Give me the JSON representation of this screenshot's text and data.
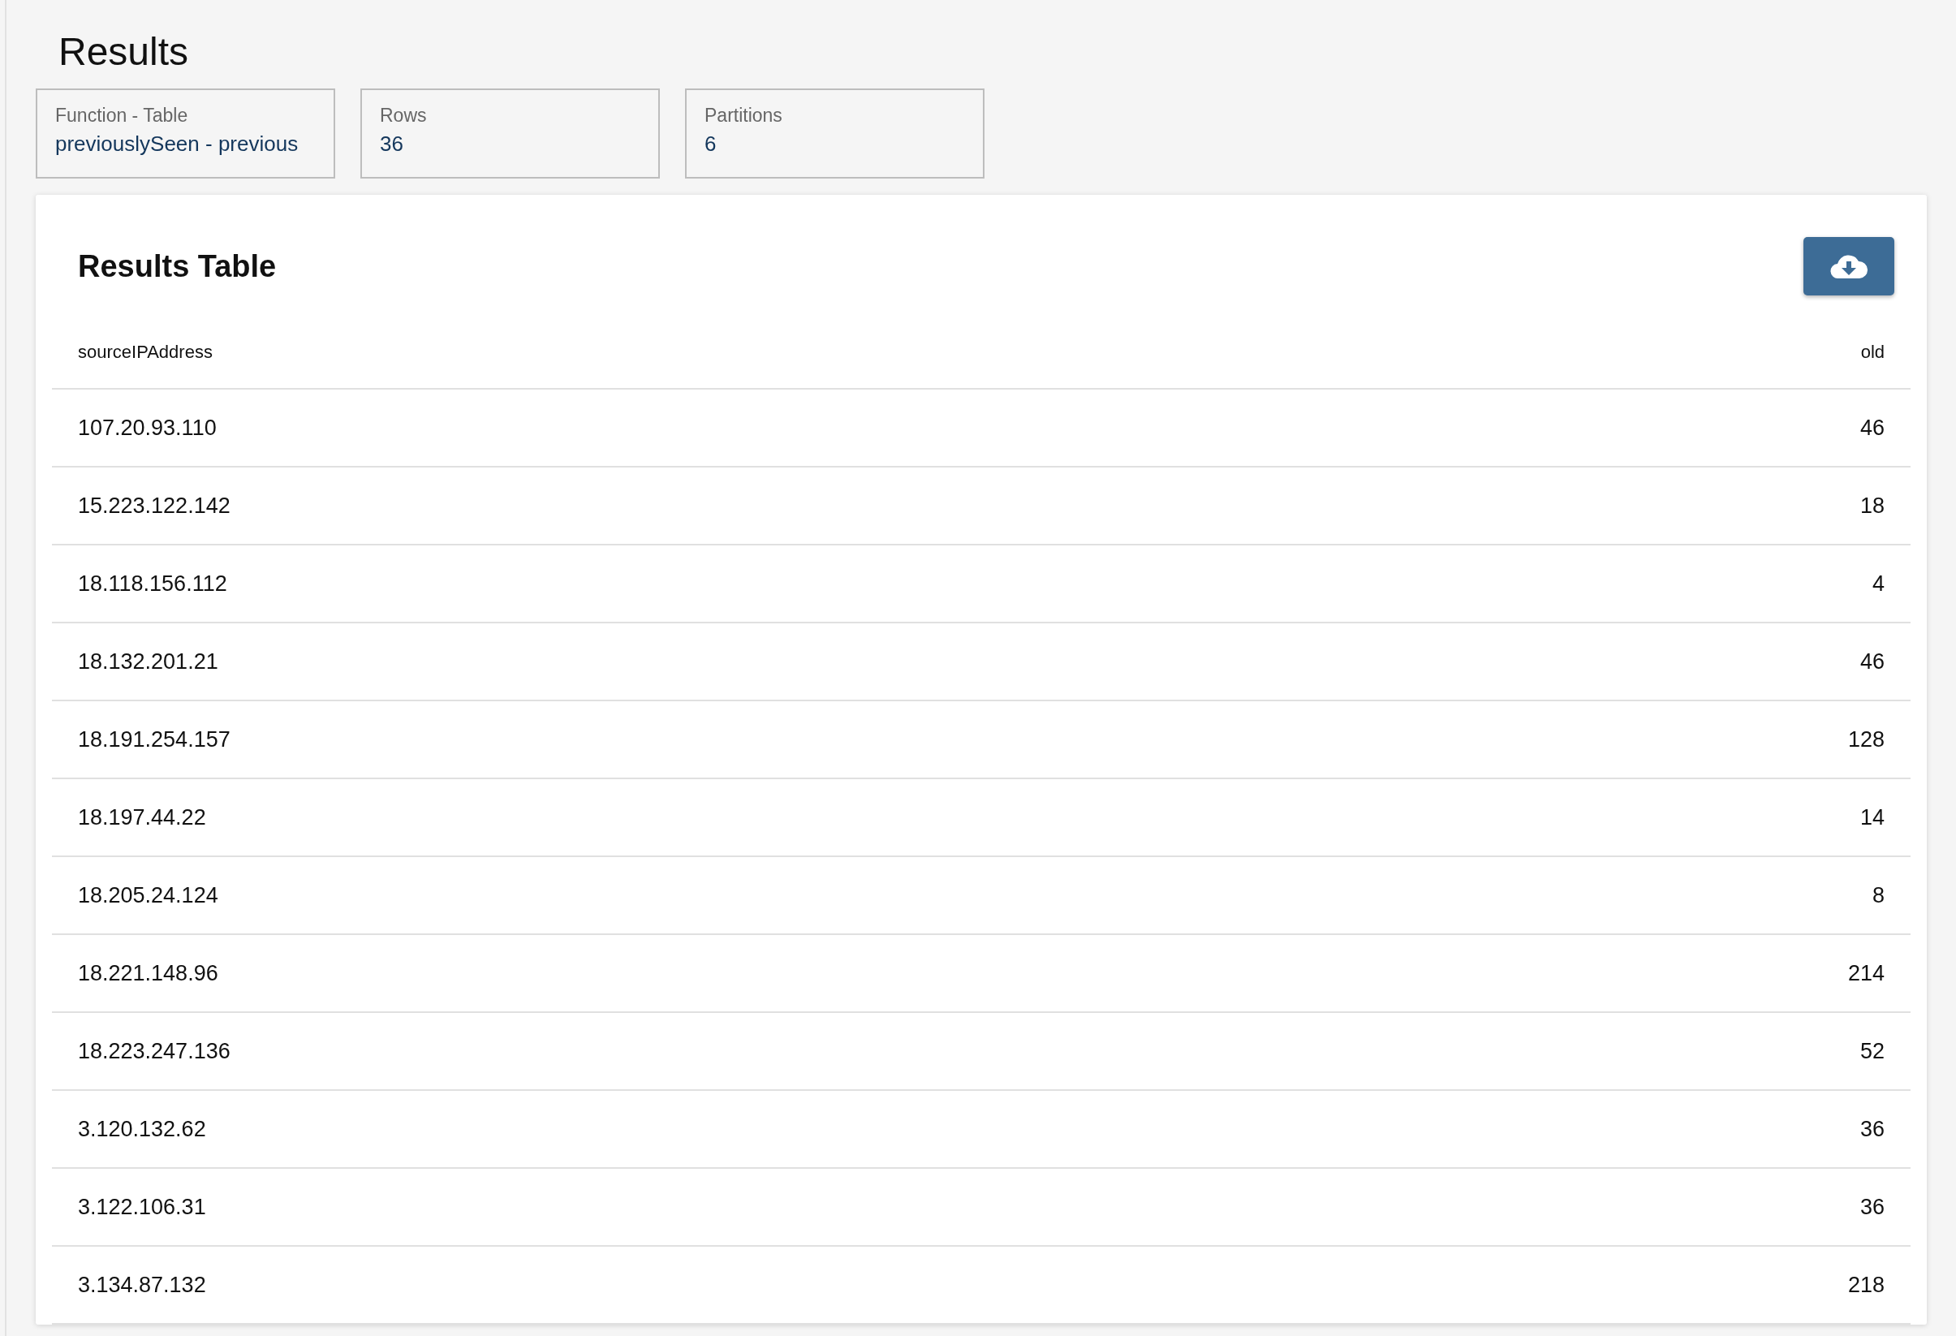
{
  "page_title": "Results",
  "stats": [
    {
      "label": "Function - Table",
      "value": "previouslySeen - previous"
    },
    {
      "label": "Rows",
      "value": "36"
    },
    {
      "label": "Partitions",
      "value": "6"
    }
  ],
  "results_table": {
    "title": "Results Table",
    "columns": [
      "sourceIPAddress",
      "old"
    ],
    "rows": [
      [
        "107.20.93.110",
        "46"
      ],
      [
        "15.223.122.142",
        "18"
      ],
      [
        "18.118.156.112",
        "4"
      ],
      [
        "18.132.201.21",
        "46"
      ],
      [
        "18.191.254.157",
        "128"
      ],
      [
        "18.197.44.22",
        "14"
      ],
      [
        "18.205.24.124",
        "8"
      ],
      [
        "18.221.148.96",
        "214"
      ],
      [
        "18.223.247.136",
        "52"
      ],
      [
        "3.120.132.62",
        "36"
      ],
      [
        "3.122.106.31",
        "36"
      ],
      [
        "3.134.87.132",
        "218"
      ]
    ]
  }
}
